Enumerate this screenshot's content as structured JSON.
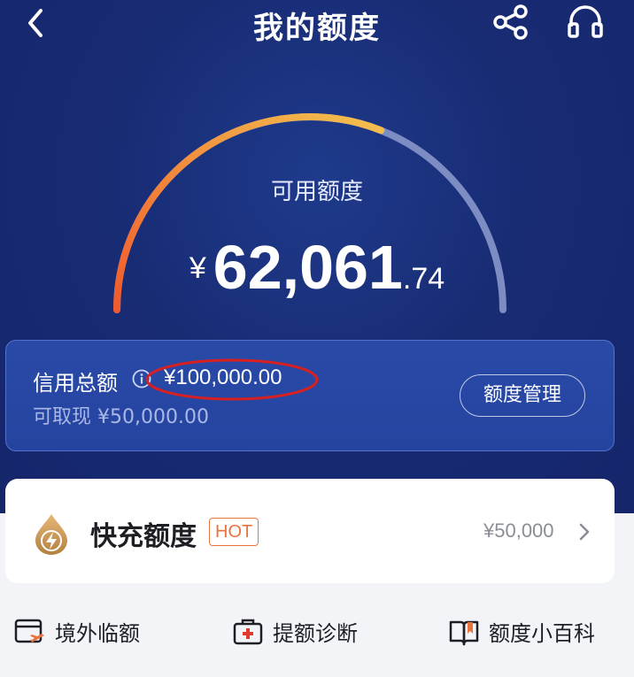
{
  "header": {
    "title": "我的额度"
  },
  "icons": {
    "back": "chevron-left-icon",
    "share": "share-icon",
    "service": "headset-icon",
    "info": "info-icon",
    "bolt": "lightning-bolt-icon",
    "chevron": "chevron-right-icon"
  },
  "gauge": {
    "label": "可用额度",
    "currency": "¥",
    "amount_int": "62,061",
    "amount_dec": ".74",
    "used_fraction": 0.62
  },
  "credit": {
    "label": "信用总额",
    "total": "¥100,000.00",
    "cash_label": "可取现",
    "cash_amount": "¥50,000.00",
    "manage_button": "额度管理"
  },
  "quick_card": {
    "title": "快充额度",
    "badge": "HOT",
    "amount": "¥50,000"
  },
  "links": [
    {
      "label": "境外临额",
      "icon": "card-plane-icon"
    },
    {
      "label": "提额诊断",
      "icon": "medical-kit-icon"
    },
    {
      "label": "额度小百科",
      "icon": "book-icon"
    }
  ],
  "colors": {
    "hero_bg": "#182c74",
    "gauge_start": "#f05a2c",
    "gauge_end": "#f3c04e",
    "gauge_track": "#7d8cc2",
    "badge": "#e9733f",
    "annotation": "#d7201f"
  }
}
